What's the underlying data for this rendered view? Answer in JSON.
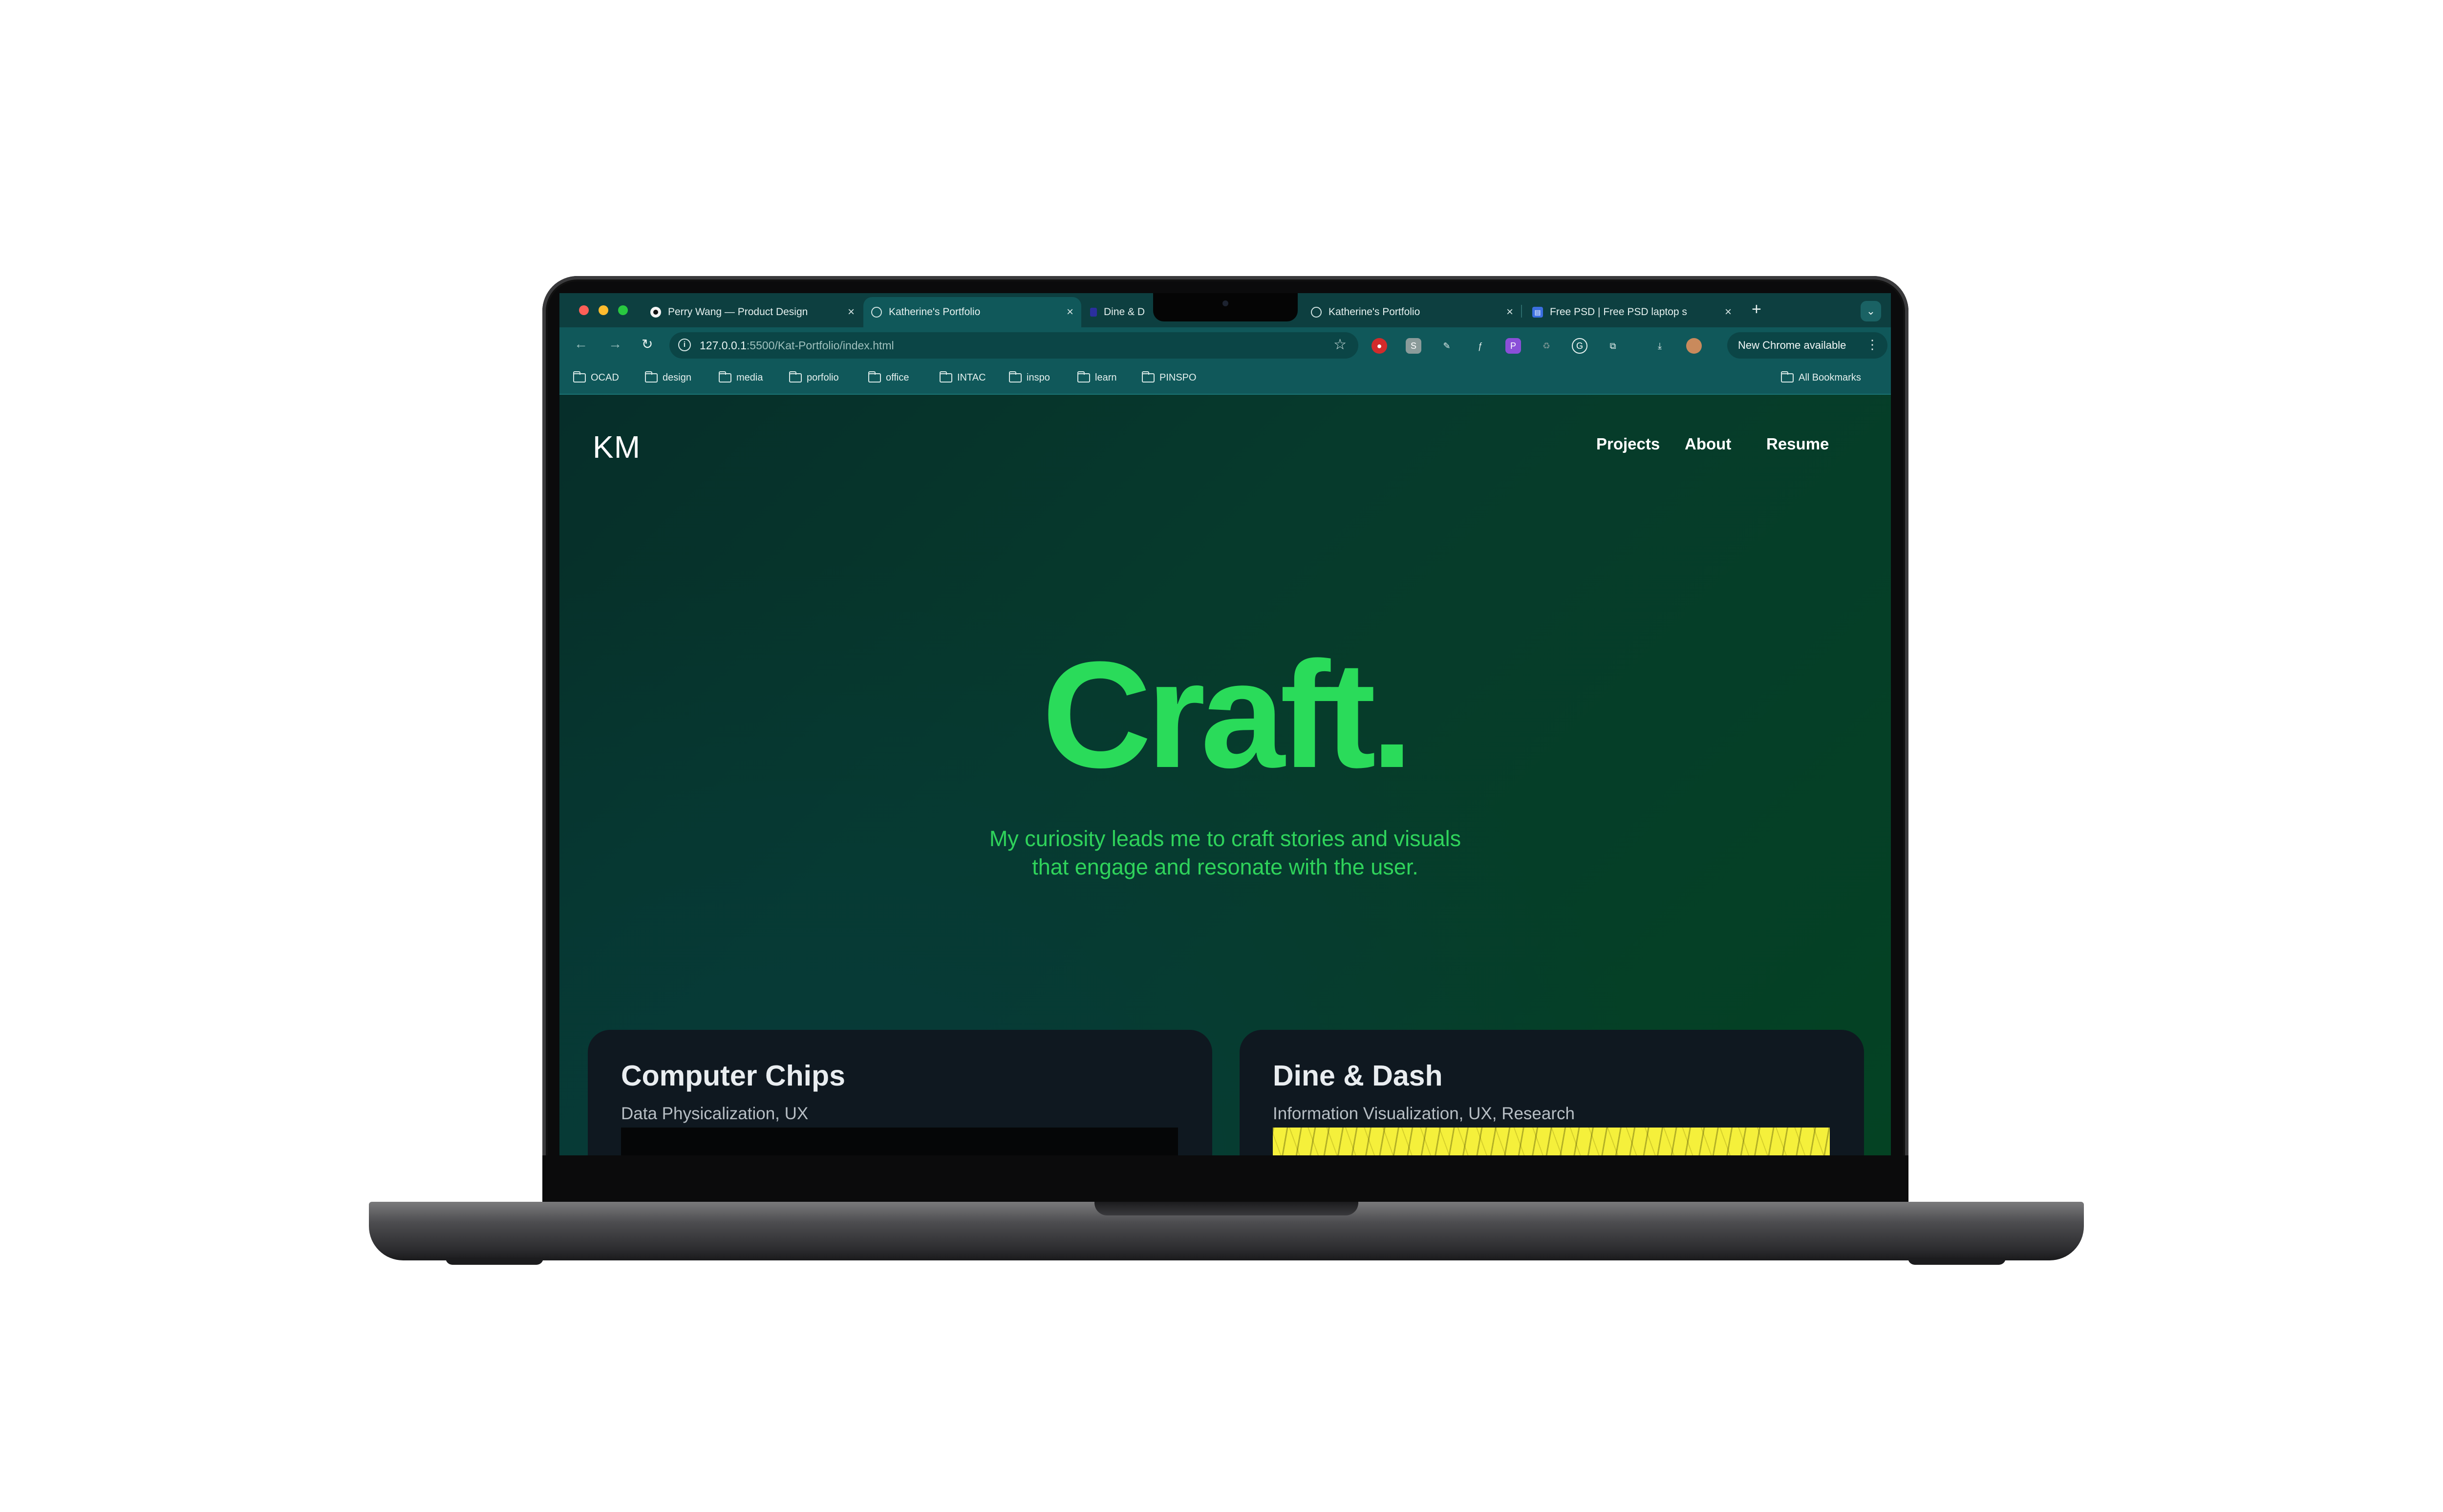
{
  "browser": {
    "tabs": [
      {
        "label": "Perry Wang — Product Design",
        "icon": "dot-icon"
      },
      {
        "label": "Katherine's Portfolio",
        "icon": "globe-icon"
      },
      {
        "label": "Dine & D",
        "icon": "dine-favicon-icon"
      },
      {
        "label": "Katherine's Portfolio",
        "icon": "globe-icon"
      },
      {
        "label": "Free PSD | Free PSD laptop s",
        "icon": "psd-favicon-icon"
      }
    ],
    "url": {
      "host": "127.0.0.1",
      "path": ":5500/Kat-Portfolio/index.html"
    },
    "new_chrome_label": "New Chrome available",
    "bookmarks": [
      "OCAD",
      "design",
      "media",
      "porfolio",
      "office",
      "INTAC",
      "inspo",
      "learn",
      "PINSPO"
    ],
    "all_bookmarks_label": "All Bookmarks"
  },
  "site": {
    "logo": "KM",
    "nav": [
      "Projects",
      "About",
      "Resume"
    ],
    "hero_title": "Craft.",
    "hero_sub_line1": "My curiosity leads me to craft stories and visuals",
    "hero_sub_line2": "that engage and resonate with the user.",
    "projects": [
      {
        "title": "Computer Chips",
        "tags": "Data Physicalization, UX"
      },
      {
        "title": "Dine & Dash",
        "tags": "Information Visualization, UX, Research"
      }
    ]
  },
  "colors": {
    "accent": "#2adb5a",
    "browser_chrome": "#10585a",
    "card_bg": "#0f1820"
  }
}
